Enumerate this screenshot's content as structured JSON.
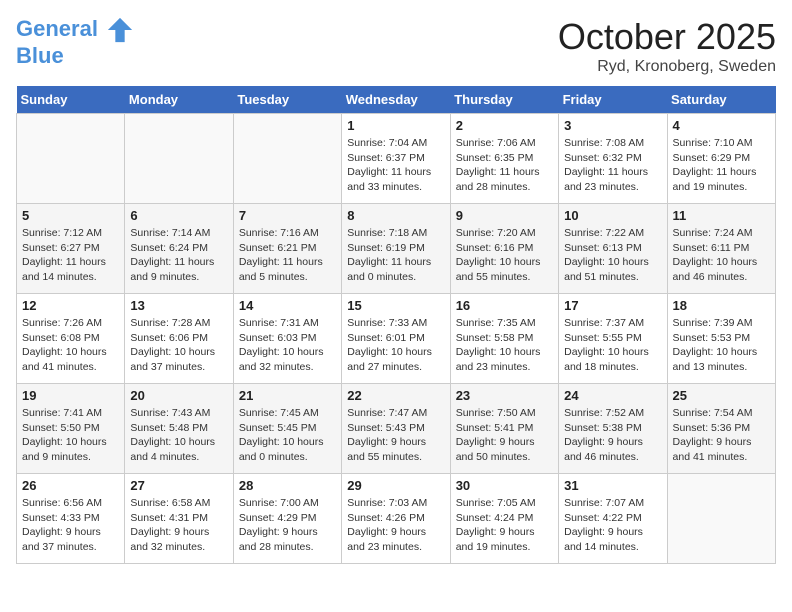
{
  "header": {
    "logo_line1": "General",
    "logo_line2": "Blue",
    "month": "October 2025",
    "location": "Ryd, Kronoberg, Sweden"
  },
  "weekdays": [
    "Sunday",
    "Monday",
    "Tuesday",
    "Wednesday",
    "Thursday",
    "Friday",
    "Saturday"
  ],
  "weeks": [
    [
      {
        "day": "",
        "info": ""
      },
      {
        "day": "",
        "info": ""
      },
      {
        "day": "",
        "info": ""
      },
      {
        "day": "1",
        "info": "Sunrise: 7:04 AM\nSunset: 6:37 PM\nDaylight: 11 hours\nand 33 minutes."
      },
      {
        "day": "2",
        "info": "Sunrise: 7:06 AM\nSunset: 6:35 PM\nDaylight: 11 hours\nand 28 minutes."
      },
      {
        "day": "3",
        "info": "Sunrise: 7:08 AM\nSunset: 6:32 PM\nDaylight: 11 hours\nand 23 minutes."
      },
      {
        "day": "4",
        "info": "Sunrise: 7:10 AM\nSunset: 6:29 PM\nDaylight: 11 hours\nand 19 minutes."
      }
    ],
    [
      {
        "day": "5",
        "info": "Sunrise: 7:12 AM\nSunset: 6:27 PM\nDaylight: 11 hours\nand 14 minutes."
      },
      {
        "day": "6",
        "info": "Sunrise: 7:14 AM\nSunset: 6:24 PM\nDaylight: 11 hours\nand 9 minutes."
      },
      {
        "day": "7",
        "info": "Sunrise: 7:16 AM\nSunset: 6:21 PM\nDaylight: 11 hours\nand 5 minutes."
      },
      {
        "day": "8",
        "info": "Sunrise: 7:18 AM\nSunset: 6:19 PM\nDaylight: 11 hours\nand 0 minutes."
      },
      {
        "day": "9",
        "info": "Sunrise: 7:20 AM\nSunset: 6:16 PM\nDaylight: 10 hours\nand 55 minutes."
      },
      {
        "day": "10",
        "info": "Sunrise: 7:22 AM\nSunset: 6:13 PM\nDaylight: 10 hours\nand 51 minutes."
      },
      {
        "day": "11",
        "info": "Sunrise: 7:24 AM\nSunset: 6:11 PM\nDaylight: 10 hours\nand 46 minutes."
      }
    ],
    [
      {
        "day": "12",
        "info": "Sunrise: 7:26 AM\nSunset: 6:08 PM\nDaylight: 10 hours\nand 41 minutes."
      },
      {
        "day": "13",
        "info": "Sunrise: 7:28 AM\nSunset: 6:06 PM\nDaylight: 10 hours\nand 37 minutes."
      },
      {
        "day": "14",
        "info": "Sunrise: 7:31 AM\nSunset: 6:03 PM\nDaylight: 10 hours\nand 32 minutes."
      },
      {
        "day": "15",
        "info": "Sunrise: 7:33 AM\nSunset: 6:01 PM\nDaylight: 10 hours\nand 27 minutes."
      },
      {
        "day": "16",
        "info": "Sunrise: 7:35 AM\nSunset: 5:58 PM\nDaylight: 10 hours\nand 23 minutes."
      },
      {
        "day": "17",
        "info": "Sunrise: 7:37 AM\nSunset: 5:55 PM\nDaylight: 10 hours\nand 18 minutes."
      },
      {
        "day": "18",
        "info": "Sunrise: 7:39 AM\nSunset: 5:53 PM\nDaylight: 10 hours\nand 13 minutes."
      }
    ],
    [
      {
        "day": "19",
        "info": "Sunrise: 7:41 AM\nSunset: 5:50 PM\nDaylight: 10 hours\nand 9 minutes."
      },
      {
        "day": "20",
        "info": "Sunrise: 7:43 AM\nSunset: 5:48 PM\nDaylight: 10 hours\nand 4 minutes."
      },
      {
        "day": "21",
        "info": "Sunrise: 7:45 AM\nSunset: 5:45 PM\nDaylight: 10 hours\nand 0 minutes."
      },
      {
        "day": "22",
        "info": "Sunrise: 7:47 AM\nSunset: 5:43 PM\nDaylight: 9 hours\nand 55 minutes."
      },
      {
        "day": "23",
        "info": "Sunrise: 7:50 AM\nSunset: 5:41 PM\nDaylight: 9 hours\nand 50 minutes."
      },
      {
        "day": "24",
        "info": "Sunrise: 7:52 AM\nSunset: 5:38 PM\nDaylight: 9 hours\nand 46 minutes."
      },
      {
        "day": "25",
        "info": "Sunrise: 7:54 AM\nSunset: 5:36 PM\nDaylight: 9 hours\nand 41 minutes."
      }
    ],
    [
      {
        "day": "26",
        "info": "Sunrise: 6:56 AM\nSunset: 4:33 PM\nDaylight: 9 hours\nand 37 minutes."
      },
      {
        "day": "27",
        "info": "Sunrise: 6:58 AM\nSunset: 4:31 PM\nDaylight: 9 hours\nand 32 minutes."
      },
      {
        "day": "28",
        "info": "Sunrise: 7:00 AM\nSunset: 4:29 PM\nDaylight: 9 hours\nand 28 minutes."
      },
      {
        "day": "29",
        "info": "Sunrise: 7:03 AM\nSunset: 4:26 PM\nDaylight: 9 hours\nand 23 minutes."
      },
      {
        "day": "30",
        "info": "Sunrise: 7:05 AM\nSunset: 4:24 PM\nDaylight: 9 hours\nand 19 minutes."
      },
      {
        "day": "31",
        "info": "Sunrise: 7:07 AM\nSunset: 4:22 PM\nDaylight: 9 hours\nand 14 minutes."
      },
      {
        "day": "",
        "info": ""
      }
    ]
  ]
}
